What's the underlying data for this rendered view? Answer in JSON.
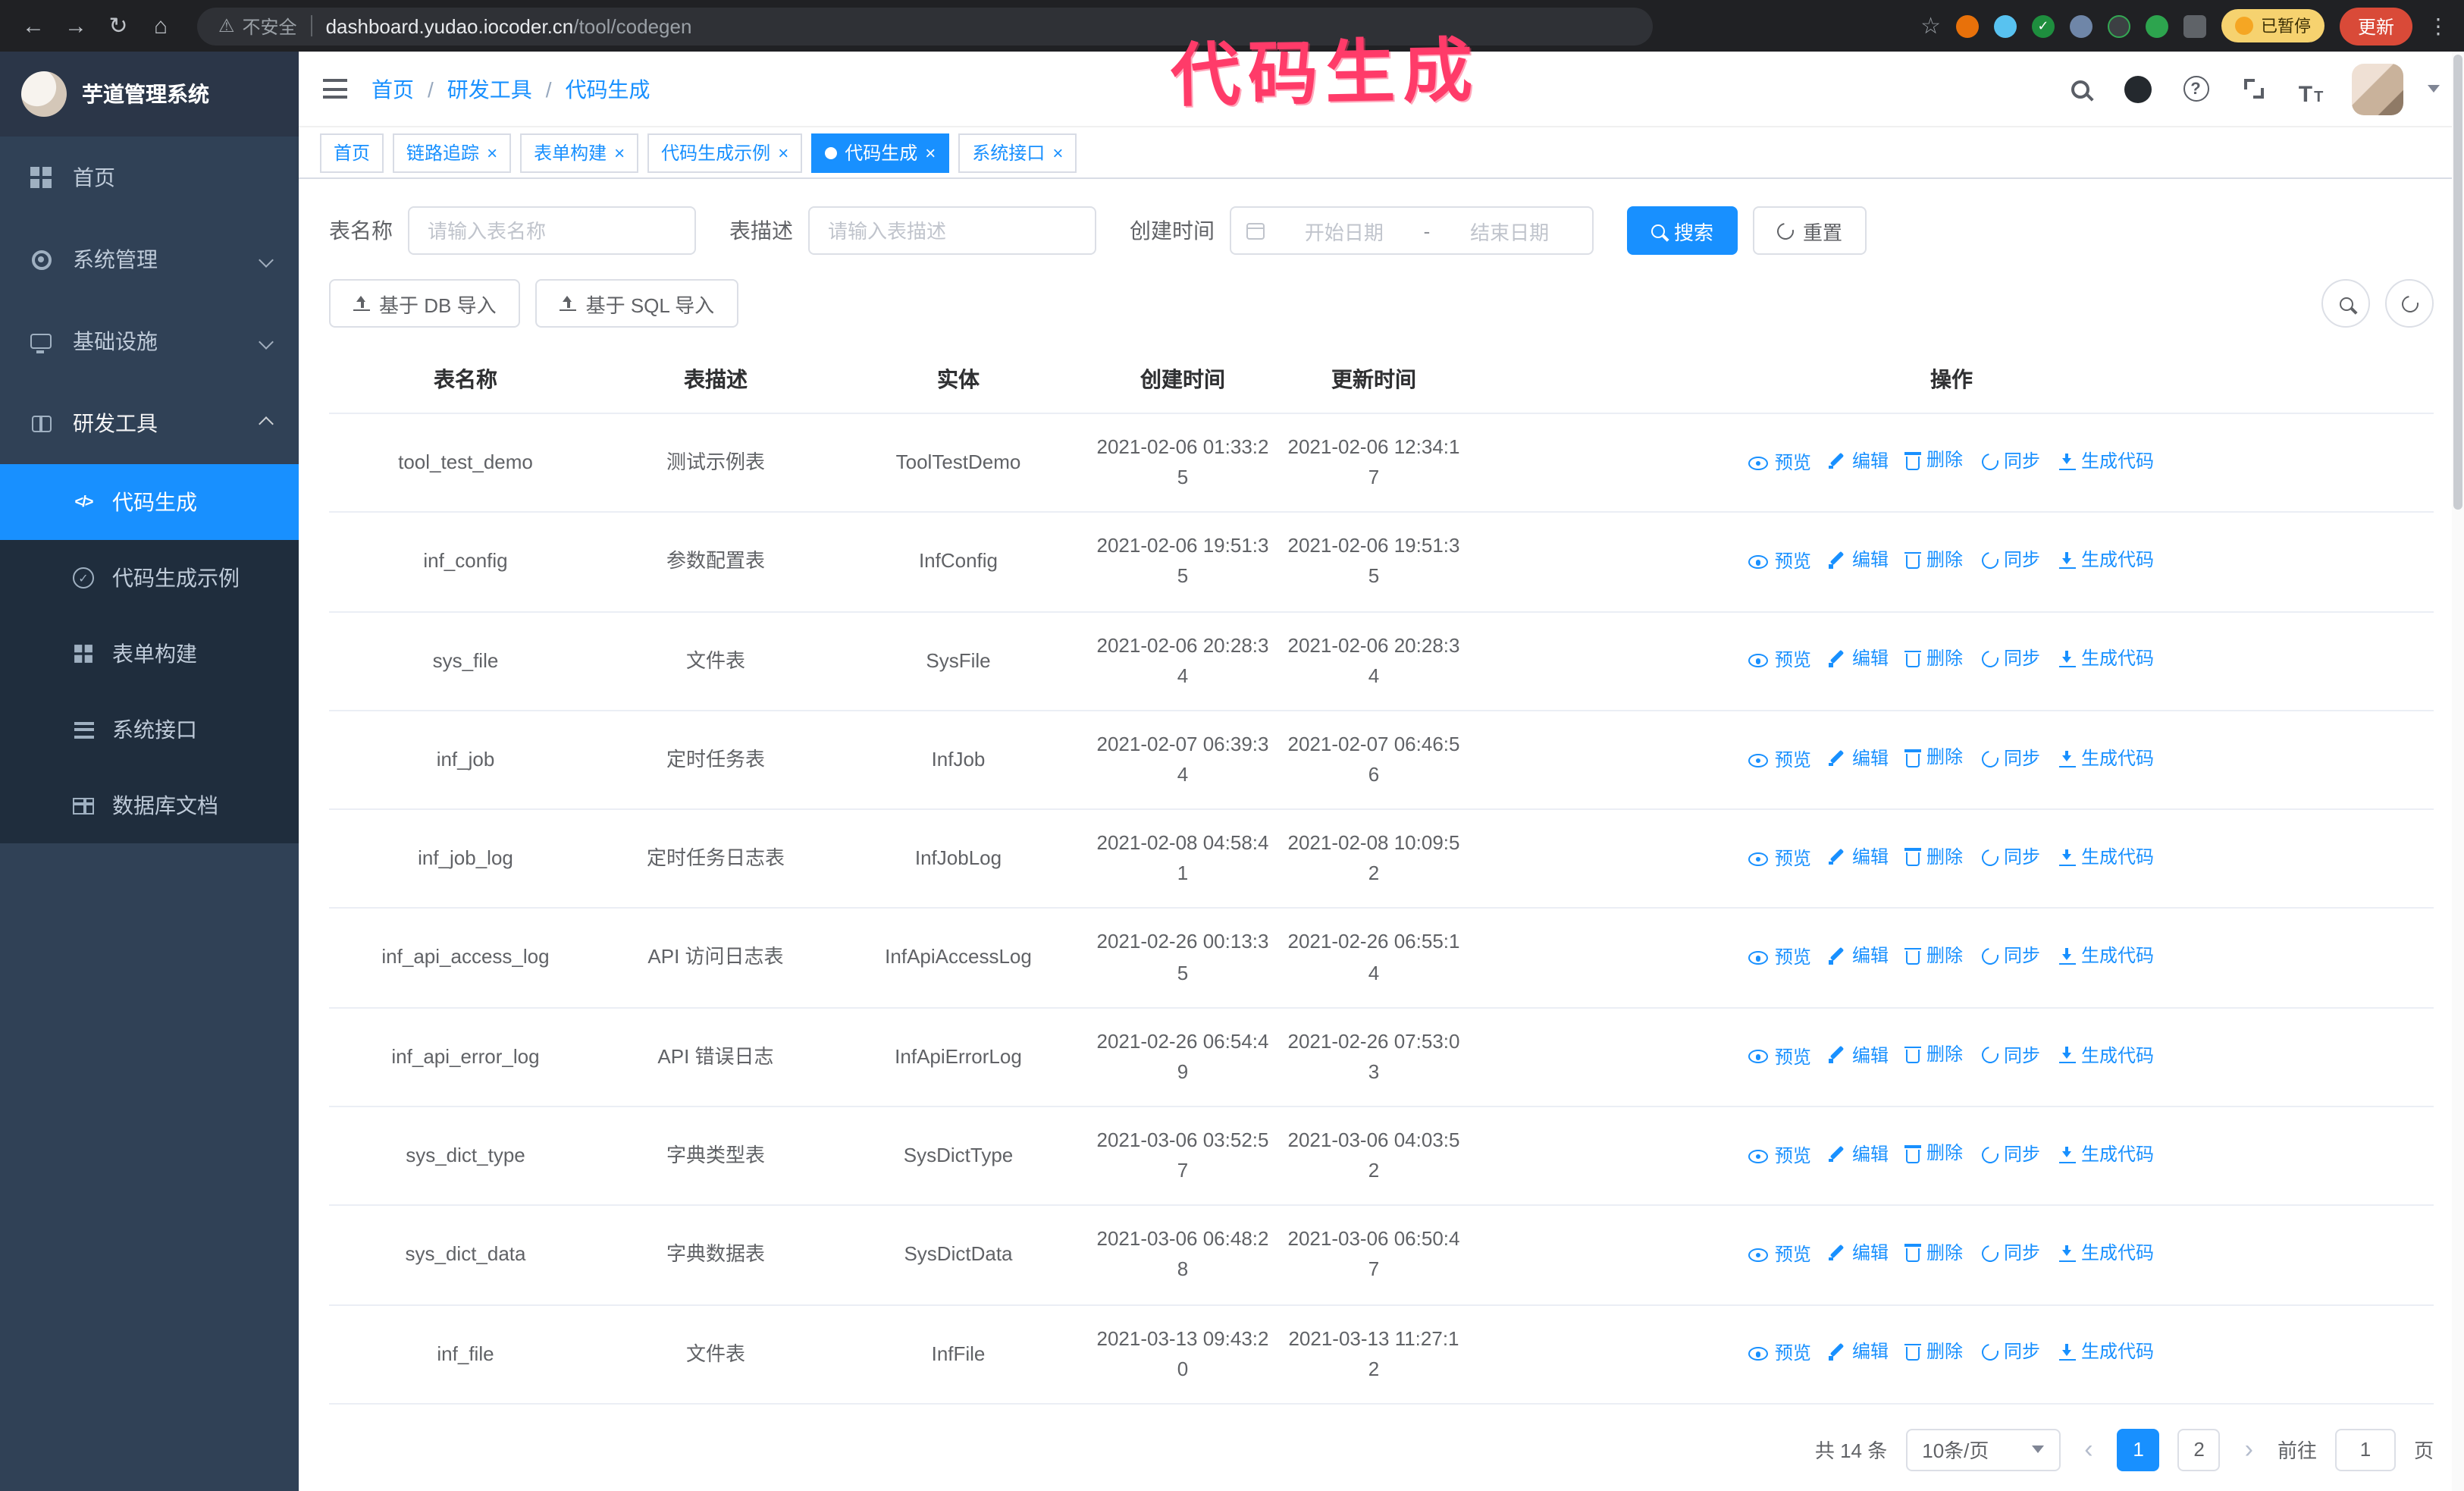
{
  "annotation": {
    "text": "代码生成"
  },
  "colors": {
    "primary": "#1890ff",
    "sidebar_bg": "#304156",
    "sidebar_sub_bg": "#1f2d3d",
    "annotation_pink": "#ff3b69",
    "update_red": "#d94a38",
    "active_tab_bg": "#1890ff"
  },
  "icons": {
    "back": "←",
    "forward": "→",
    "reload": "↻",
    "home": "⌂",
    "warning": "⚠",
    "star": "☆",
    "kebab": "⋮",
    "slash": "/",
    "close": "×",
    "question": "?",
    "textsize": "T",
    "check": "✓",
    "code": "</>",
    "prev": "‹",
    "next": "›"
  },
  "browser": {
    "insecure_label": "不安全",
    "url_host": "dashboard.yudao.iocoder.cn",
    "url_path": "/tool/codegen",
    "paused_badge": "已暂停",
    "update_button": "更新"
  },
  "sidebar": {
    "app_title": "芋道管理系统",
    "items": [
      {
        "label": "首页"
      },
      {
        "label": "系统管理"
      },
      {
        "label": "基础设施"
      },
      {
        "label": "研发工具"
      }
    ],
    "sub_items": [
      {
        "label": "代码生成"
      },
      {
        "label": "代码生成示例"
      },
      {
        "label": "表单构建"
      },
      {
        "label": "系统接口"
      },
      {
        "label": "数据库文档"
      }
    ]
  },
  "navbar": {
    "breadcrumb": [
      "首页",
      "研发工具",
      "代码生成"
    ]
  },
  "tabs": [
    {
      "label": "首页"
    },
    {
      "label": "链路追踪"
    },
    {
      "label": "表单构建"
    },
    {
      "label": "代码生成示例"
    },
    {
      "label": "代码生成"
    },
    {
      "label": "系统接口"
    }
  ],
  "filters": {
    "name_label": "表名称",
    "name_placeholder": "请输入表名称",
    "desc_label": "表描述",
    "desc_placeholder": "请输入表描述",
    "time_label": "创建时间",
    "start_placeholder": "开始日期",
    "range_separator": "-",
    "end_placeholder": "结束日期",
    "search_button": "搜索",
    "reset_button": "重置"
  },
  "toolbar": {
    "db_import": "基于 DB 导入",
    "sql_import": "基于 SQL 导入"
  },
  "table": {
    "columns": [
      "表名称",
      "表描述",
      "实体",
      "创建时间",
      "更新时间",
      "操作"
    ],
    "actions": {
      "preview": "预览",
      "edit": "编辑",
      "delete": "删除",
      "sync": "同步",
      "generate": "生成代码"
    },
    "rows": [
      {
        "name": "tool_test_demo",
        "desc": "测试示例表",
        "entity": "ToolTestDemo",
        "created": "2021-02-06 01:33:25",
        "updated": "2021-02-06 12:34:17"
      },
      {
        "name": "inf_config",
        "desc": "参数配置表",
        "entity": "InfConfig",
        "created": "2021-02-06 19:51:35",
        "updated": "2021-02-06 19:51:35"
      },
      {
        "name": "sys_file",
        "desc": "文件表",
        "entity": "SysFile",
        "created": "2021-02-06 20:28:34",
        "updated": "2021-02-06 20:28:34"
      },
      {
        "name": "inf_job",
        "desc": "定时任务表",
        "entity": "InfJob",
        "created": "2021-02-07 06:39:34",
        "updated": "2021-02-07 06:46:56"
      },
      {
        "name": "inf_job_log",
        "desc": "定时任务日志表",
        "entity": "InfJobLog",
        "created": "2021-02-08 04:58:41",
        "updated": "2021-02-08 10:09:52"
      },
      {
        "name": "inf_api_access_log",
        "desc": "API 访问日志表",
        "entity": "InfApiAccessLog",
        "created": "2021-02-26 00:13:35",
        "updated": "2021-02-26 06:55:14"
      },
      {
        "name": "inf_api_error_log",
        "desc": "API 错误日志",
        "entity": "InfApiErrorLog",
        "created": "2021-02-26 06:54:49",
        "updated": "2021-02-26 07:53:03"
      },
      {
        "name": "sys_dict_type",
        "desc": "字典类型表",
        "entity": "SysDictType",
        "created": "2021-03-06 03:52:57",
        "updated": "2021-03-06 04:03:52"
      },
      {
        "name": "sys_dict_data",
        "desc": "字典数据表",
        "entity": "SysDictData",
        "created": "2021-03-06 06:48:28",
        "updated": "2021-03-06 06:50:47"
      },
      {
        "name": "inf_file",
        "desc": "文件表",
        "entity": "InfFile",
        "created": "2021-03-13 09:43:20",
        "updated": "2021-03-13 11:27:12"
      }
    ]
  },
  "pagination": {
    "total": "共 14 条",
    "page_size": "10条/页",
    "page1": "1",
    "page2": "2",
    "goto_label": "前往",
    "goto_value": "1",
    "page_unit": "页"
  }
}
